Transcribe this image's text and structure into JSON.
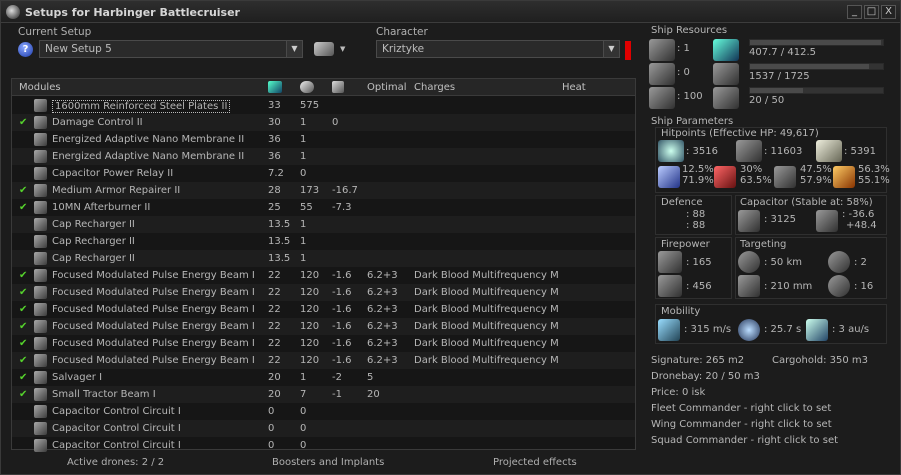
{
  "window": {
    "title": "Setups for Harbinger Battlecruiser",
    "min_label": "_",
    "max_label": "□",
    "close_label": "X"
  },
  "setup": {
    "label": "Current Setup",
    "value": "New Setup 5",
    "help_label": "?"
  },
  "character": {
    "label": "Character",
    "value": "Kriztyke"
  },
  "modules_table": {
    "columns": [
      "Modules",
      "",
      "",
      "",
      "Optimal",
      "Charges",
      "Heat"
    ],
    "rows": [
      {
        "checked": false,
        "name": "1600mm Reinforced Steel Plates II",
        "c1": "33",
        "c2": "575",
        "c3": "",
        "optimal": "",
        "charges": ""
      },
      {
        "checked": true,
        "name": "Damage Control II",
        "c1": "30",
        "c2": "1",
        "c3": "0",
        "optimal": "",
        "charges": ""
      },
      {
        "checked": false,
        "name": "Energized Adaptive Nano Membrane II",
        "c1": "36",
        "c2": "1",
        "c3": "",
        "optimal": "",
        "charges": ""
      },
      {
        "checked": false,
        "name": "Energized Adaptive Nano Membrane II",
        "c1": "36",
        "c2": "1",
        "c3": "",
        "optimal": "",
        "charges": ""
      },
      {
        "checked": false,
        "name": "Capacitor Power Relay II",
        "c1": "7.2",
        "c2": "0",
        "c3": "",
        "optimal": "",
        "charges": ""
      },
      {
        "checked": true,
        "name": "Medium Armor Repairer II",
        "c1": "28",
        "c2": "173",
        "c3": "-16.7",
        "optimal": "",
        "charges": ""
      },
      {
        "checked": true,
        "name": "10MN Afterburner II",
        "c1": "25",
        "c2": "55",
        "c3": "-7.3",
        "optimal": "",
        "charges": ""
      },
      {
        "checked": false,
        "name": "Cap Recharger II",
        "c1": "13.5",
        "c2": "1",
        "c3": "",
        "optimal": "",
        "charges": ""
      },
      {
        "checked": false,
        "name": "Cap Recharger II",
        "c1": "13.5",
        "c2": "1",
        "c3": "",
        "optimal": "",
        "charges": ""
      },
      {
        "checked": false,
        "name": "Cap Recharger II",
        "c1": "13.5",
        "c2": "1",
        "c3": "",
        "optimal": "",
        "charges": ""
      },
      {
        "checked": true,
        "name": "Focused Modulated Pulse Energy Beam I",
        "c1": "22",
        "c2": "120",
        "c3": "-1.6",
        "optimal": "6.2+3",
        "charges": "Dark Blood Multifrequency M"
      },
      {
        "checked": true,
        "name": "Focused Modulated Pulse Energy Beam I",
        "c1": "22",
        "c2": "120",
        "c3": "-1.6",
        "optimal": "6.2+3",
        "charges": "Dark Blood Multifrequency M"
      },
      {
        "checked": true,
        "name": "Focused Modulated Pulse Energy Beam I",
        "c1": "22",
        "c2": "120",
        "c3": "-1.6",
        "optimal": "6.2+3",
        "charges": "Dark Blood Multifrequency M"
      },
      {
        "checked": true,
        "name": "Focused Modulated Pulse Energy Beam I",
        "c1": "22",
        "c2": "120",
        "c3": "-1.6",
        "optimal": "6.2+3",
        "charges": "Dark Blood Multifrequency M"
      },
      {
        "checked": true,
        "name": "Focused Modulated Pulse Energy Beam I",
        "c1": "22",
        "c2": "120",
        "c3": "-1.6",
        "optimal": "6.2+3",
        "charges": "Dark Blood Multifrequency M"
      },
      {
        "checked": true,
        "name": "Focused Modulated Pulse Energy Beam I",
        "c1": "22",
        "c2": "120",
        "c3": "-1.6",
        "optimal": "6.2+3",
        "charges": "Dark Blood Multifrequency M"
      },
      {
        "checked": true,
        "name": "Salvager I",
        "c1": "20",
        "c2": "1",
        "c3": "-2",
        "optimal": "5",
        "charges": ""
      },
      {
        "checked": true,
        "name": "Small Tractor Beam I",
        "c1": "20",
        "c2": "7",
        "c3": "-1",
        "optimal": "20",
        "charges": ""
      },
      {
        "checked": false,
        "name": "Capacitor Control Circuit I",
        "c1": "0",
        "c2": "0",
        "c3": "",
        "optimal": "",
        "charges": ""
      },
      {
        "checked": false,
        "name": "Capacitor Control Circuit I",
        "c1": "0",
        "c2": "0",
        "c3": "",
        "optimal": "",
        "charges": ""
      },
      {
        "checked": false,
        "name": "Capacitor Control Circuit I",
        "c1": "0",
        "c2": "0",
        "c3": "",
        "optimal": "",
        "charges": ""
      }
    ]
  },
  "bottom": {
    "drones": "Active drones: 2 / 2",
    "boosters": "Boosters and Implants",
    "projected": "Projected effects"
  },
  "resources": {
    "title": "Ship Resources",
    "hardpoints_turret": ": 1",
    "hardpoints_launcher": ": 0",
    "calibration": ": 100",
    "cpu": "407.7 / 412.5",
    "cpu_fraction": 0.988,
    "powergrid": "1537 / 1725",
    "powergrid_fraction": 0.891,
    "drone_bay": "20 / 50",
    "drone_bay_fraction": 0.4
  },
  "params": {
    "title": "Ship Parameters",
    "hitpoints": "Hitpoints (Effective HP: 49,617)",
    "shield": ": 3516",
    "armor": ": 11603",
    "hull": ": 5391",
    "em_top": "12.5%",
    "em_bot": "71.9%",
    "th_top": "30%",
    "th_bot": "63.5%",
    "ki_top": "47.5%",
    "ki_bot": "57.9%",
    "ex_top": "56.3%",
    "ex_bot": "55.1%",
    "defence_title": "Defence",
    "defence_a": ": 88",
    "defence_b": ": 88",
    "capacitor_title": "Capacitor (Stable at: 58%)",
    "capacitor": ": 3125",
    "cap_delta_a": ": -36.6",
    "cap_delta_b": "+48.4",
    "firepower_title": "Firepower",
    "firepower_a": ": 165",
    "firepower_b": ": 456",
    "targeting_title": "Targeting",
    "target_range": ": 50 km",
    "max_targets": ": 2",
    "sig_res": ": 210 mm",
    "sensor": ": 16",
    "mobility_title": "Mobility",
    "speed": ": 315 m/s",
    "align": ": 25.7 s",
    "warp": ": 3 au/s",
    "signature": "Signature: 265 m2",
    "cargohold": "Cargohold: 350 m3",
    "dronebay": "Dronebay: 20 / 50 m3",
    "price": "Price: 0 isk",
    "fleet_cmd": "Fleet Commander - right click to set",
    "wing_cmd": "Wing Commander - right click to set",
    "squad_cmd": "Squad Commander - right click to set"
  }
}
